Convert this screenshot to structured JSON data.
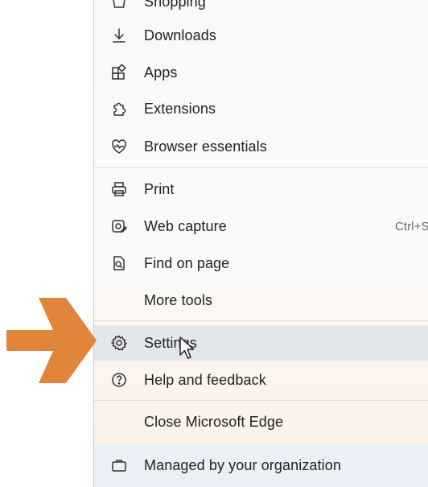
{
  "menu": {
    "items": [
      {
        "id": "shopping",
        "label": "Shopping",
        "icon": "shopping-icon"
      },
      {
        "id": "downloads",
        "label": "Downloads",
        "icon": "download-icon"
      },
      {
        "id": "apps",
        "label": "Apps",
        "icon": "apps-icon"
      },
      {
        "id": "extensions",
        "label": "Extensions",
        "icon": "extensions-puzzle-icon"
      },
      {
        "id": "browser-essentials",
        "label": "Browser essentials",
        "icon": "heart-pulse-icon"
      },
      {
        "id": "print",
        "label": "Print",
        "icon": "printer-icon"
      },
      {
        "id": "web-capture",
        "label": "Web capture",
        "icon": "web-capture-icon",
        "shortcut": "Ctrl+S"
      },
      {
        "id": "find-on-page",
        "label": "Find on page",
        "icon": "find-on-page-icon"
      },
      {
        "id": "more-tools",
        "label": "More tools"
      },
      {
        "id": "settings",
        "label": "Settings",
        "icon": "gear-icon",
        "state": "hovered"
      },
      {
        "id": "help",
        "label": "Help and feedback",
        "icon": "help-question-icon"
      },
      {
        "id": "close-edge",
        "label": "Close Microsoft Edge"
      },
      {
        "id": "managed",
        "label": "Managed by your organization",
        "icon": "briefcase-icon"
      }
    ]
  },
  "annotation": {
    "arrow_color": "#e0853a",
    "arrow_target": "settings",
    "icon": "arrow-right-icon"
  },
  "colors": {
    "hover_bg": "#e3e6ea",
    "managed_bg": "#eaf0f6",
    "text": "#222222",
    "separator": "#dedede"
  }
}
